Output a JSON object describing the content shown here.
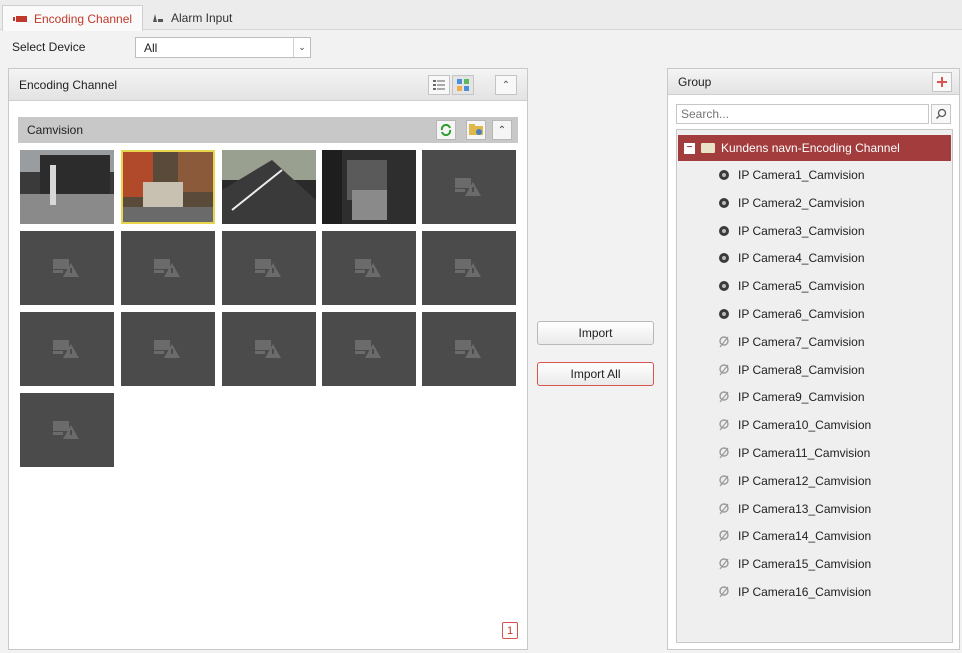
{
  "tabs": [
    {
      "label": "Encoding Channel",
      "icon": "camera-icon",
      "active": true
    },
    {
      "label": "Alarm Input",
      "icon": "alarm-icon",
      "active": false
    }
  ],
  "device_select": {
    "label": "Select Device",
    "value": "All"
  },
  "left_panel": {
    "title": "Encoding Channel",
    "group_name": "Camvision",
    "page": "1"
  },
  "buttons": {
    "import": "Import",
    "import_all": "Import All"
  },
  "right_panel": {
    "title": "Group",
    "search_placeholder": "Search...",
    "root_label": "Kundens navn-Encoding Channel",
    "items": [
      {
        "label": "IP Camera1_Camvision",
        "online": true
      },
      {
        "label": "IP Camera2_Camvision",
        "online": true
      },
      {
        "label": "IP Camera3_Camvision",
        "online": true
      },
      {
        "label": "IP Camera4_Camvision",
        "online": true
      },
      {
        "label": "IP Camera5_Camvision",
        "online": true
      },
      {
        "label": "IP Camera6_Camvision",
        "online": true
      },
      {
        "label": "IP Camera7_Camvision",
        "online": false
      },
      {
        "label": "IP Camera8_Camvision",
        "online": false
      },
      {
        "label": "IP Camera9_Camvision",
        "online": false
      },
      {
        "label": "IP Camera10_Camvision",
        "online": false
      },
      {
        "label": "IP Camera11_Camvision",
        "online": false
      },
      {
        "label": "IP Camera12_Camvision",
        "online": false
      },
      {
        "label": "IP Camera13_Camvision",
        "online": false
      },
      {
        "label": "IP Camera14_Camvision",
        "online": false
      },
      {
        "label": "IP Camera15_Camvision",
        "online": false
      },
      {
        "label": "IP Camera16_Camvision",
        "online": false
      }
    ]
  },
  "colors": {
    "accent": "#c0392b",
    "selected_row": "#a33c3c",
    "thumb_bg": "#4b4b4b",
    "thumb_selected_border": "#e8d44d"
  }
}
